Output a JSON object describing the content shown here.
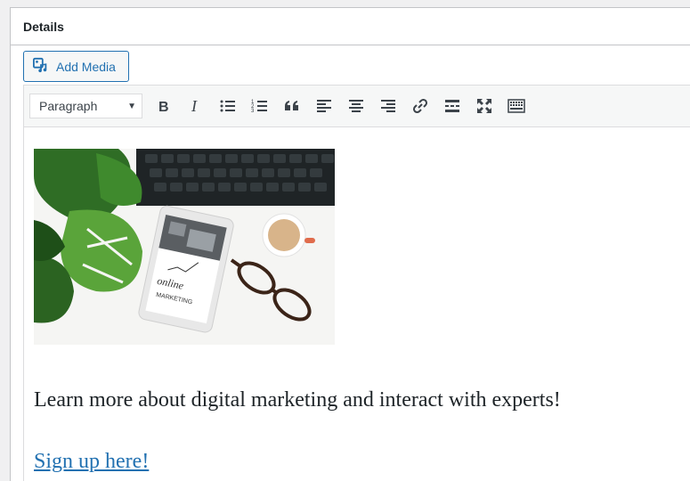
{
  "postbox": {
    "title": "Details"
  },
  "media": {
    "add_media_label": "Add Media"
  },
  "toolbar": {
    "format_selected": "Paragraph",
    "buttons": [
      {
        "name": "bold",
        "icon": "bold-icon"
      },
      {
        "name": "italic",
        "icon": "italic-icon"
      },
      {
        "name": "bulleted-list",
        "icon": "bulleted-list-icon"
      },
      {
        "name": "numbered-list",
        "icon": "numbered-list-icon"
      },
      {
        "name": "blockquote",
        "icon": "blockquote-icon"
      },
      {
        "name": "align-left",
        "icon": "align-left-icon"
      },
      {
        "name": "align-center",
        "icon": "align-center-icon"
      },
      {
        "name": "align-right",
        "icon": "align-right-icon"
      },
      {
        "name": "insert-link",
        "icon": "link-icon"
      },
      {
        "name": "read-more",
        "icon": "read-more-icon"
      },
      {
        "name": "fullscreen",
        "icon": "fullscreen-icon"
      },
      {
        "name": "toolbar-toggle",
        "icon": "keyboard-icon"
      }
    ]
  },
  "content": {
    "paragraph": "Learn more about digital marketing and interact with experts!",
    "link_text": "Sign up here!",
    "tablet_text": "online MARKETING"
  },
  "colors": {
    "accent": "#2271b1",
    "border": "#c3c4c7",
    "toolbar_bg": "#f6f7f7",
    "text": "#1d2327"
  }
}
